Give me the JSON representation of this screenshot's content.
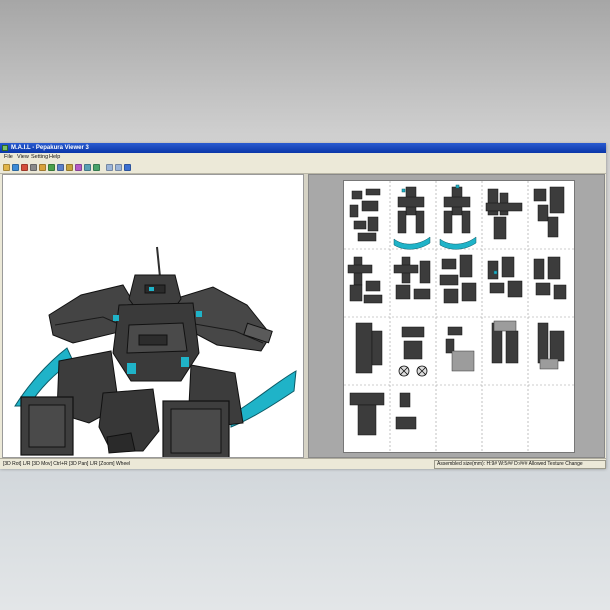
{
  "window": {
    "title": "M.A.I.L - Pepakura Viewer 3"
  },
  "menu": {
    "items": [
      "File",
      "View",
      "Setting",
      "Help"
    ]
  },
  "toolbar": {
    "buttons": [
      {
        "icon": "open-folder-icon",
        "color": "#e1b54a"
      },
      {
        "icon": "globe-icon",
        "color": "#3d8bd6"
      },
      {
        "icon": "texture-icon",
        "color": "#d44d3a"
      },
      {
        "icon": "print-icon",
        "color": "#8a8a8a"
      },
      {
        "icon": "palette-icon",
        "color": "#d9a23c"
      },
      {
        "icon": "eye-icon",
        "color": "#4aa04a"
      },
      {
        "icon": "zoom-icon",
        "color": "#5b7fc7"
      },
      {
        "icon": "pencil-icon",
        "color": "#c7a23c"
      },
      {
        "icon": "pin-icon",
        "color": "#b55ac7"
      },
      {
        "icon": "tool-icon",
        "color": "#5aa0b5"
      },
      {
        "icon": "grid-icon",
        "color": "#47a36a"
      },
      {
        "icon": "window-icon",
        "color": "#9cb5d9"
      },
      {
        "icon": "window-split-icon",
        "color": "#9cb5d9"
      },
      {
        "icon": "info-icon",
        "color": "#3b6fd1"
      }
    ]
  },
  "model": {
    "accent_color": "#1fb3c8",
    "body_color": "#3b3b3b"
  },
  "status": {
    "left": "[3D Rot] L/R [3D Mov] Ctrl+R [3D Pan] L/R [Zoom] Wheel",
    "right": "Assembled size(mm): H:9# W:5## D:### Allowed Texture Change"
  }
}
